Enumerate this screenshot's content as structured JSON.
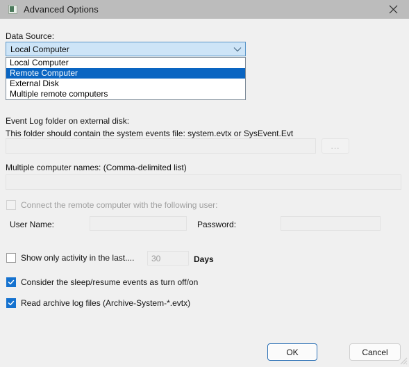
{
  "window": {
    "title": "Advanced Options",
    "icon": "app-icon",
    "close_icon": "close-icon",
    "titlebar_color": "#bcbcbc",
    "background_color": "#f0f0f0"
  },
  "data_source": {
    "label": "Data Source:",
    "selected": "Local Computer",
    "dropdown_open": true,
    "dropdown_arrow_icon": "chevron-down-icon",
    "highlight_color": "#0a65c2",
    "options": [
      {
        "label": "Local Computer",
        "highlighted": false
      },
      {
        "label": "Remote Computer",
        "highlighted": true
      },
      {
        "label": "External Disk",
        "highlighted": false
      },
      {
        "label": "Multiple remote computers",
        "highlighted": false
      }
    ]
  },
  "event_log_folder": {
    "label": "Event Log folder on external disk:",
    "hint": "This folder should contain the system events file: system.evtx or SysEvent.Evt",
    "value": "",
    "placeholder": "",
    "disabled": true,
    "browse_label": "...",
    "browse_icon": "ellipsis-icon"
  },
  "multiple_computers": {
    "label": "Multiple computer names: (Comma-delimited list)",
    "value": "",
    "placeholder": "",
    "disabled": true
  },
  "remote_user": {
    "checkbox_label": "Connect the remote computer with the following user:",
    "checked": false,
    "disabled": true,
    "user_name_label": "User Name:",
    "user_name_value": "",
    "password_label": "Password:",
    "password_value": ""
  },
  "activity_filter": {
    "checkbox_label": "Show only activity in the last....",
    "checked": false,
    "days_value": "30",
    "days_label": "Days",
    "days_disabled": true
  },
  "options": [
    {
      "label": "Consider the sleep/resume events as turn off/on",
      "checked": true,
      "name": "consider-sleep-resume-checkbox"
    },
    {
      "label": "Read archive log files (Archive-System-*.evtx)",
      "checked": true,
      "name": "read-archive-logs-checkbox"
    }
  ],
  "footer": {
    "ok_label": "OK",
    "cancel_label": "Cancel",
    "accent_color": "#2a6fb4"
  }
}
